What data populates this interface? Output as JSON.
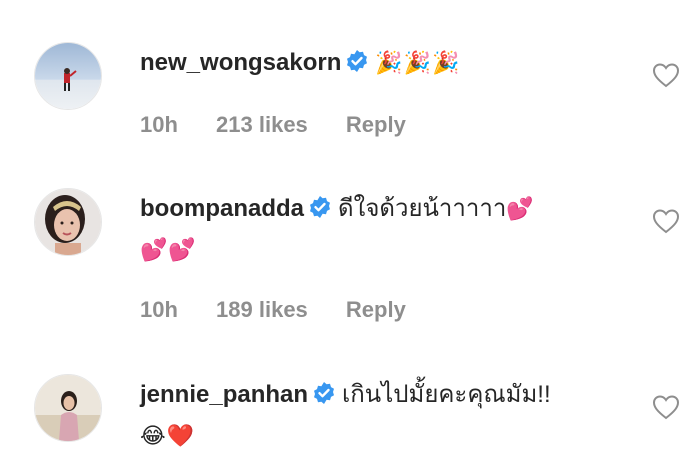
{
  "comments": [
    {
      "username": "new_wongsakorn",
      "text": "",
      "emoji_line1": "🎉🎉🎉",
      "emoji_line2": "",
      "time": "10h",
      "likes": "213 likes",
      "reply": "Reply",
      "icons": [
        "verified-badge-icon",
        "party-popper-icon",
        "heart-outline-icon"
      ]
    },
    {
      "username": "boompanadda",
      "text": "ดีใจด้วยน้าาาาา",
      "emoji_line1": "💕",
      "emoji_line2": "💕💕",
      "time": "10h",
      "likes": "189 likes",
      "reply": "Reply",
      "icons": [
        "verified-badge-icon",
        "two-hearts-icon",
        "heart-outline-icon"
      ]
    },
    {
      "username": "jennie_panhan",
      "text": "เกินไปมั้ยคะคุณมัม!!",
      "emoji_line1": "",
      "emoji_line2": "😂❤️",
      "icons": [
        "verified-badge-icon",
        "tears-of-joy-icon",
        "red-heart-icon",
        "heart-outline-icon"
      ]
    }
  ],
  "colors": {
    "text": "#262626",
    "meta": "#8e8e8e",
    "verified": "#3897f0"
  }
}
